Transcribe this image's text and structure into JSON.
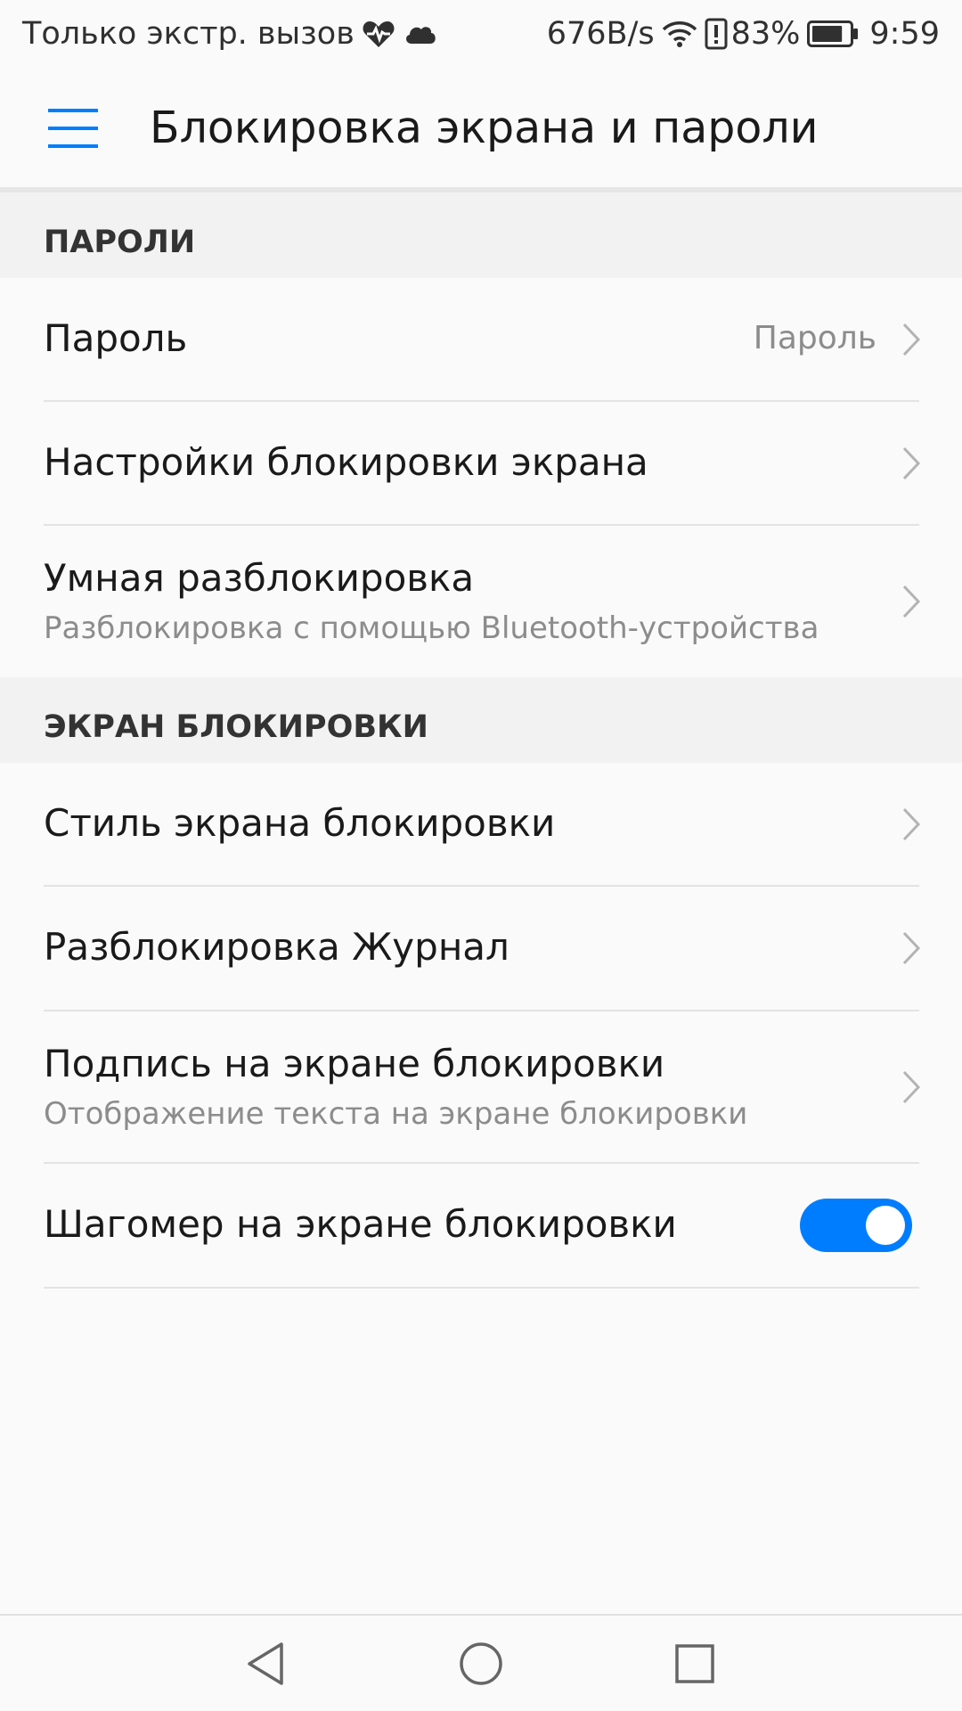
{
  "status_bar": {
    "carrier_text": "Только экстр. вызов",
    "icons_left": [
      "health-heart-icon",
      "cloud-icon"
    ],
    "network_speed": "676B/s",
    "icons_right": [
      "wifi-icon",
      "battery-alert-icon"
    ],
    "battery_percent": "83%",
    "battery_level": 0.83,
    "time": "9:59"
  },
  "header": {
    "title": "Блокировка экрана и пароли",
    "menu_icon": "hamburger-menu-icon"
  },
  "colors": {
    "accent": "#007dff",
    "background": "#fafafa",
    "section_background": "#f2f2f2",
    "secondary_text": "#8c8c8c"
  },
  "sections": [
    {
      "header": "ПАРОЛИ",
      "items": [
        {
          "title": "Пароль",
          "value": "Пароль",
          "control": "chevron"
        },
        {
          "title": "Настройки блокировки экрана",
          "control": "chevron"
        },
        {
          "title": "Умная разблокировка",
          "subtitle": "Разблокировка с помощью Bluetooth-устройства",
          "control": "chevron"
        }
      ]
    },
    {
      "header": "ЭКРАН БЛОКИРОВКИ",
      "items": [
        {
          "title": "Стиль экрана блокировки",
          "control": "chevron"
        },
        {
          "title": "Разблокировка Журнал",
          "control": "chevron"
        },
        {
          "title": "Подпись на экране блокировки",
          "subtitle": "Отображение текста на экране блокировки",
          "control": "chevron"
        },
        {
          "title": "Шагомер на экране блокировки",
          "control": "toggle",
          "toggle_on": true
        }
      ]
    }
  ],
  "nav_bar": {
    "buttons": [
      "back-icon",
      "home-icon",
      "recents-icon"
    ]
  }
}
